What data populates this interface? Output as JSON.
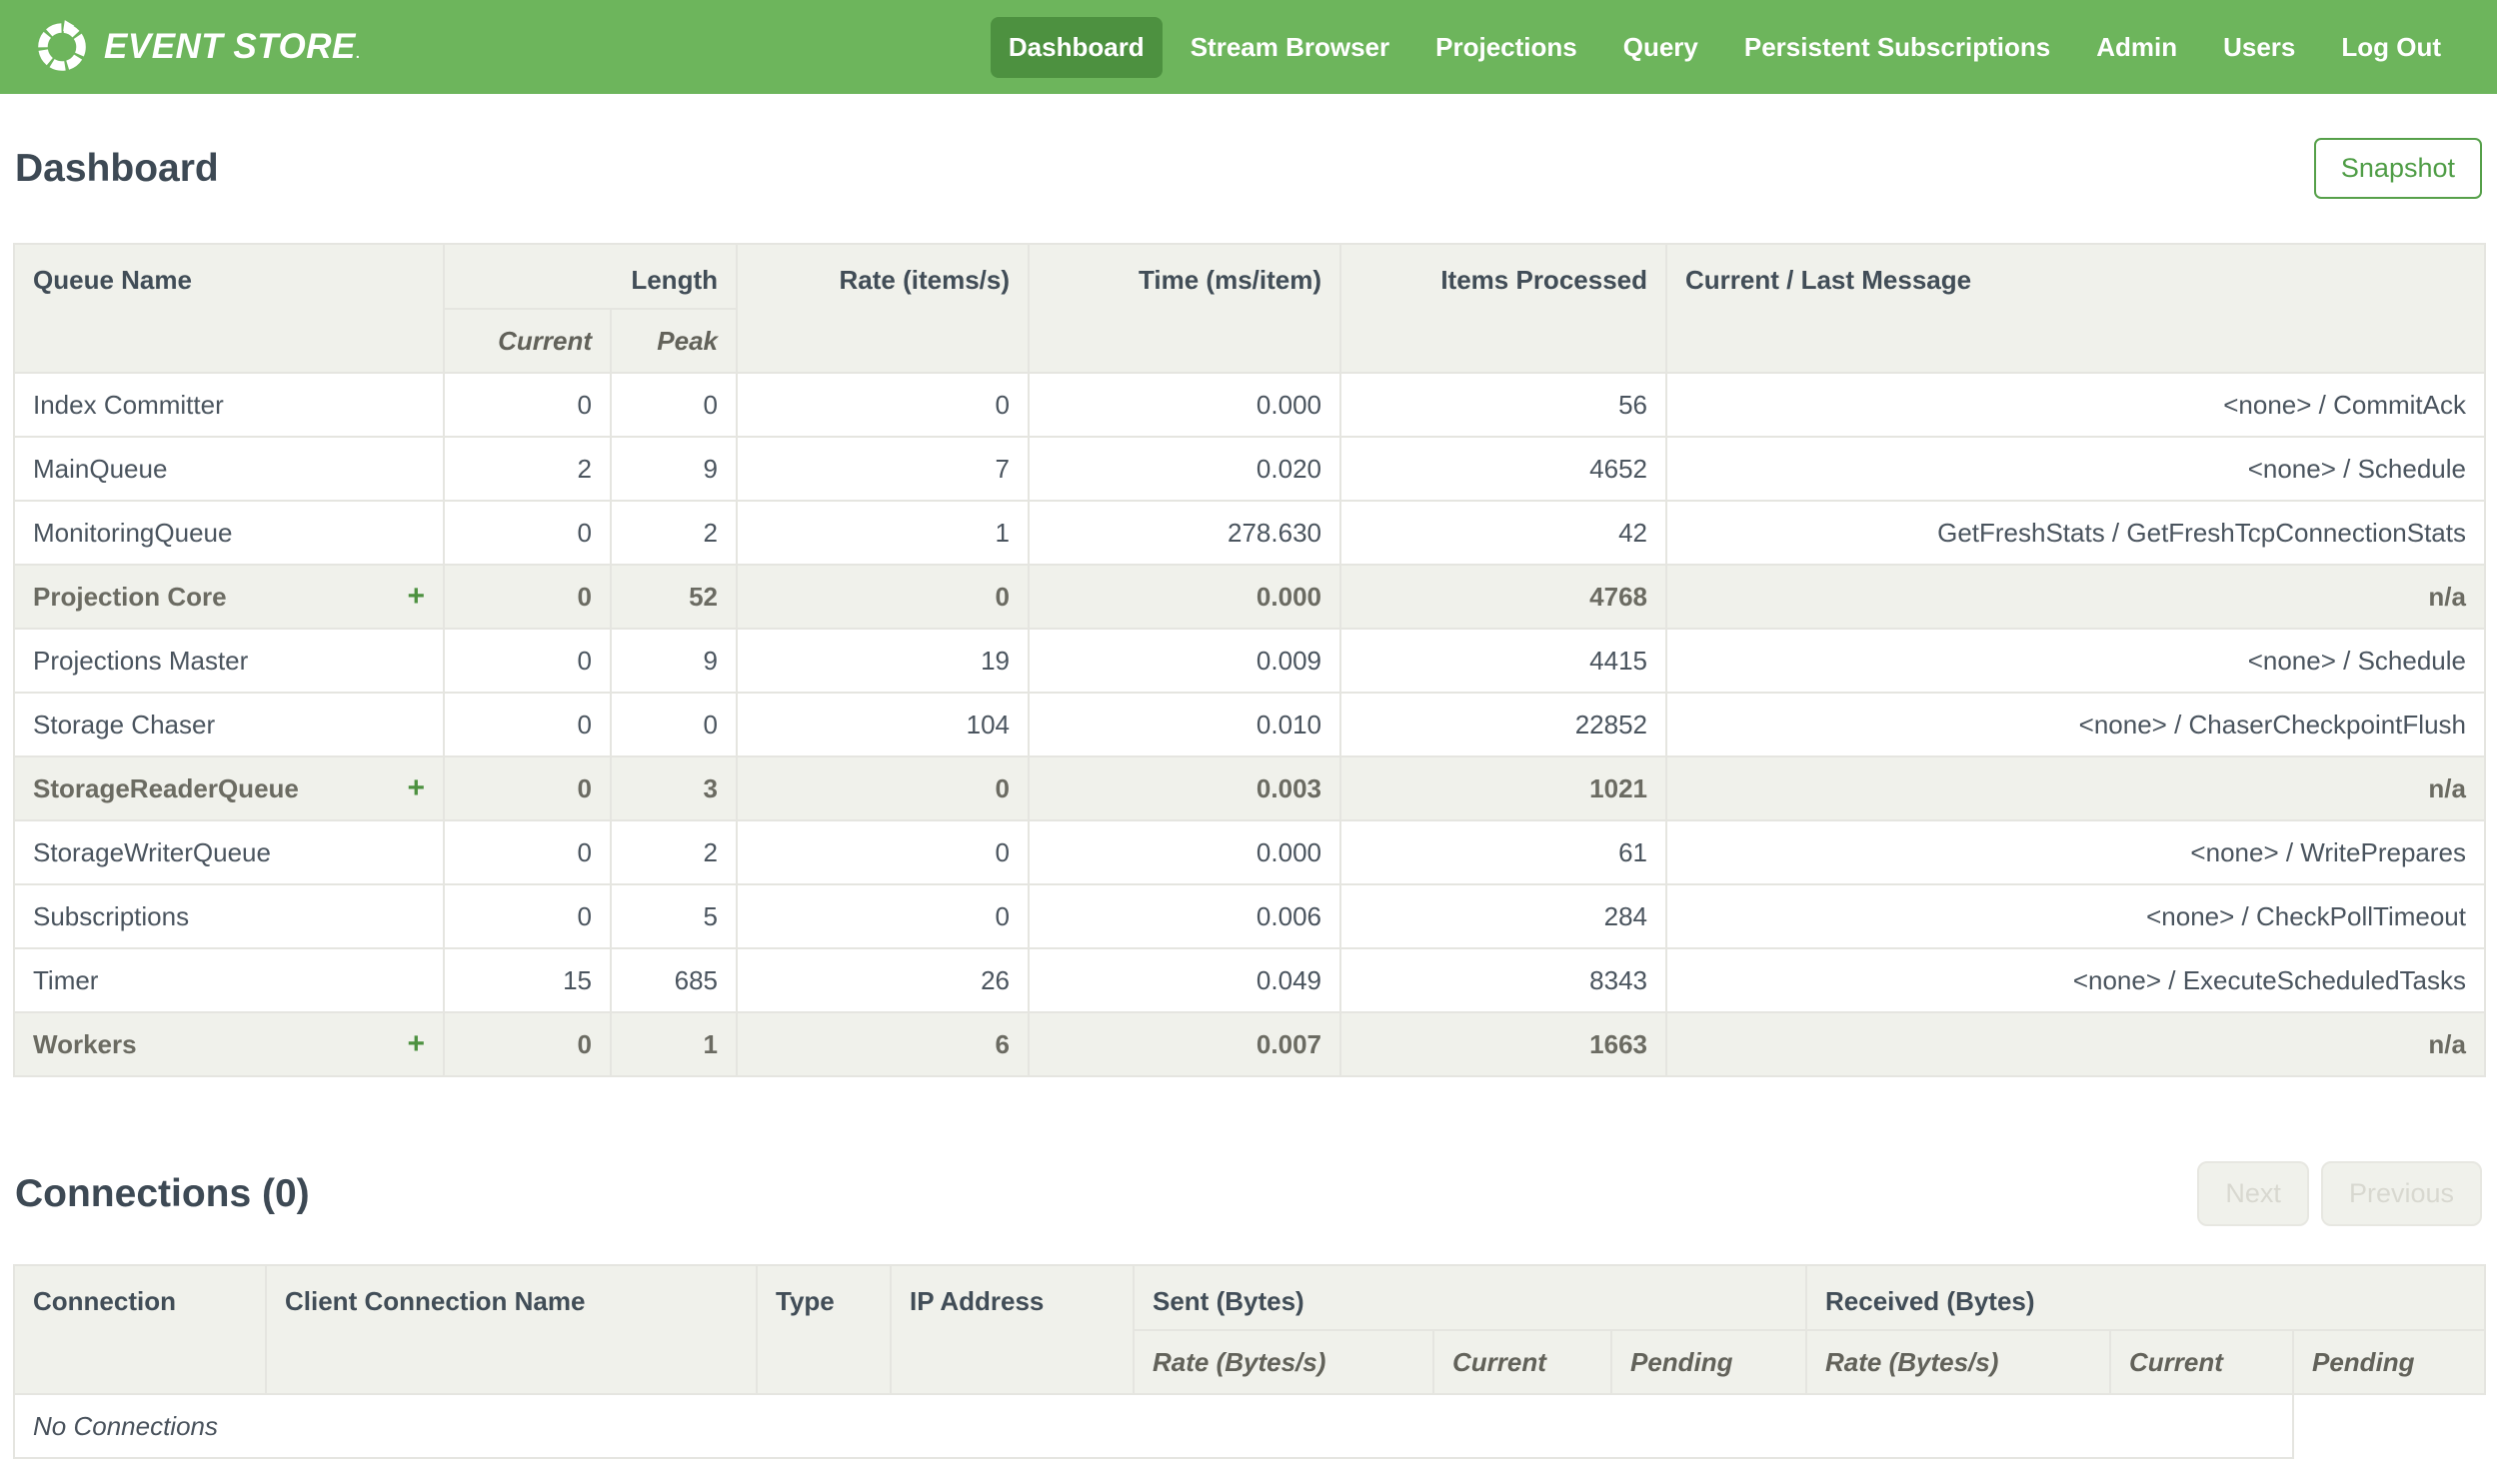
{
  "nav": {
    "brand": "EVENT STORE",
    "brand_mark": ".",
    "items": [
      {
        "id": "dashboard",
        "label": "Dashboard",
        "active": true
      },
      {
        "id": "stream-browser",
        "label": "Stream Browser",
        "active": false
      },
      {
        "id": "projections",
        "label": "Projections",
        "active": false
      },
      {
        "id": "query",
        "label": "Query",
        "active": false
      },
      {
        "id": "persistent-subscriptions",
        "label": "Persistent Subscriptions",
        "active": false
      },
      {
        "id": "admin",
        "label": "Admin",
        "active": false
      },
      {
        "id": "users",
        "label": "Users",
        "active": false
      },
      {
        "id": "log-out",
        "label": "Log Out",
        "active": false
      }
    ]
  },
  "page": {
    "title": "Dashboard",
    "snapshot_label": "Snapshot"
  },
  "queues": {
    "columns": {
      "queue_name": "Queue Name",
      "length": "Length",
      "current": "Current",
      "peak": "Peak",
      "rate": "Rate (items/s)",
      "time": "Time (ms/item)",
      "items": "Items Processed",
      "message": "Current / Last Message"
    },
    "rows": [
      {
        "name": "Index Committer",
        "expandable": false,
        "current": "0",
        "peak": "0",
        "rate": "0",
        "time": "0.000",
        "items": "56",
        "message": "<none> / CommitAck"
      },
      {
        "name": "MainQueue",
        "expandable": false,
        "current": "2",
        "peak": "9",
        "rate": "7",
        "time": "0.020",
        "items": "4652",
        "message": "<none> / Schedule"
      },
      {
        "name": "MonitoringQueue",
        "expandable": false,
        "current": "0",
        "peak": "2",
        "rate": "1",
        "time": "278.630",
        "items": "42",
        "message": "GetFreshStats / GetFreshTcpConnectionStats"
      },
      {
        "name": "Projection Core",
        "expandable": true,
        "current": "0",
        "peak": "52",
        "rate": "0",
        "time": "0.000",
        "items": "4768",
        "message": "n/a"
      },
      {
        "name": "Projections Master",
        "expandable": false,
        "current": "0",
        "peak": "9",
        "rate": "19",
        "time": "0.009",
        "items": "4415",
        "message": "<none> / Schedule"
      },
      {
        "name": "Storage Chaser",
        "expandable": false,
        "current": "0",
        "peak": "0",
        "rate": "104",
        "time": "0.010",
        "items": "22852",
        "message": "<none> / ChaserCheckpointFlush"
      },
      {
        "name": "StorageReaderQueue",
        "expandable": true,
        "current": "0",
        "peak": "3",
        "rate": "0",
        "time": "0.003",
        "items": "1021",
        "message": "n/a"
      },
      {
        "name": "StorageWriterQueue",
        "expandable": false,
        "current": "0",
        "peak": "2",
        "rate": "0",
        "time": "0.000",
        "items": "61",
        "message": "<none> / WritePrepares"
      },
      {
        "name": "Subscriptions",
        "expandable": false,
        "current": "0",
        "peak": "5",
        "rate": "0",
        "time": "0.006",
        "items": "284",
        "message": "<none> / CheckPollTimeout"
      },
      {
        "name": "Timer",
        "expandable": false,
        "current": "15",
        "peak": "685",
        "rate": "26",
        "time": "0.049",
        "items": "8343",
        "message": "<none> / ExecuteScheduledTasks"
      },
      {
        "name": "Workers",
        "expandable": true,
        "current": "0",
        "peak": "1",
        "rate": "6",
        "time": "0.007",
        "items": "1663",
        "message": "n/a"
      }
    ]
  },
  "connections": {
    "title": "Connections (0)",
    "next_label": "Next",
    "previous_label": "Previous",
    "columns": {
      "connection": "Connection",
      "client_name": "Client Connection Name",
      "type": "Type",
      "ip": "IP Address",
      "sent": "Sent (Bytes)",
      "received": "Received (Bytes)",
      "rate": "Rate (Bytes/s)",
      "current": "Current",
      "pending": "Pending"
    },
    "empty_message": "No Connections"
  },
  "colors": {
    "nav_green": "#6db55c",
    "nav_active_green": "#4d9140",
    "button_green": "#4f9d46",
    "header_bg": "#f0f1eb",
    "border": "#e5e5e0",
    "text": "#49525c",
    "group_text": "#6b6b62",
    "disabled_text": "#d8d8d0"
  }
}
